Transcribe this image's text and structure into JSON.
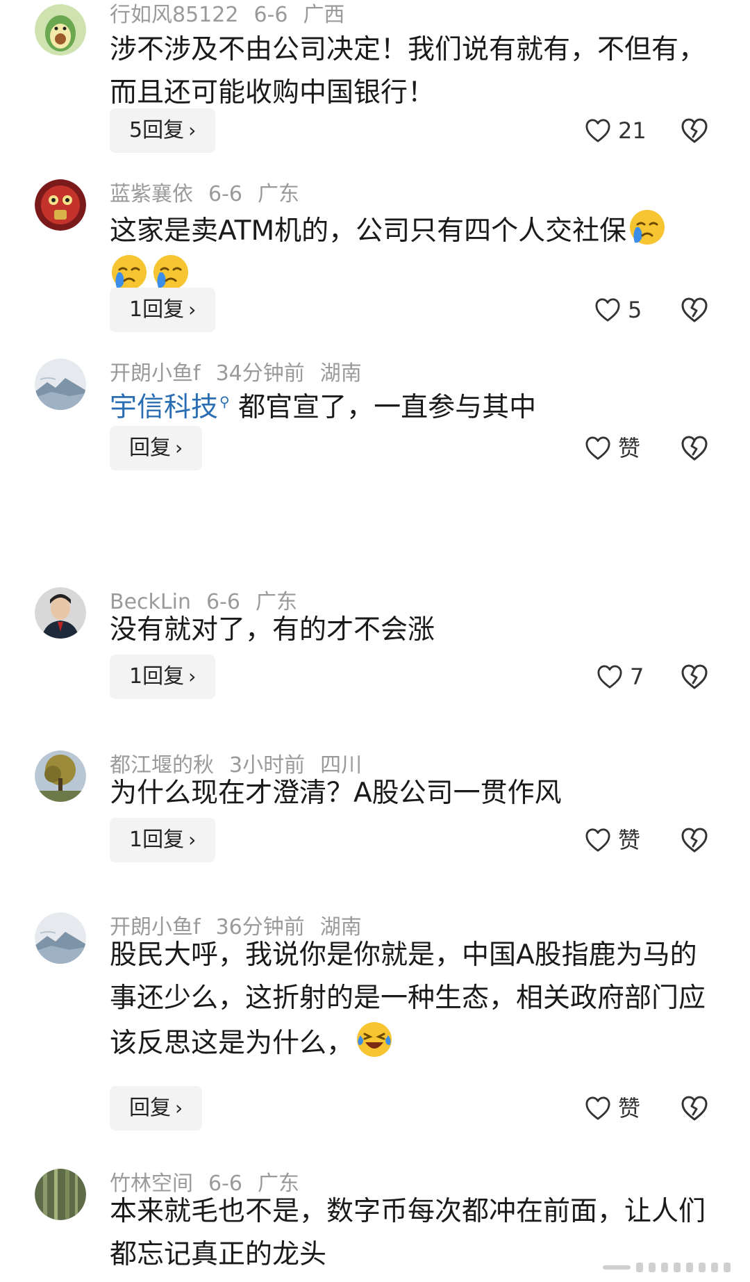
{
  "comments": [
    {
      "user": "行如风85122",
      "date": "6-6",
      "region": "广西",
      "text": "涉不涉及不由公司决定！我们说有就有，不但有，而且还可能收购中国银行！",
      "reply_label": "5回复",
      "like_label": "21"
    },
    {
      "user": "蓝紫襄依",
      "date": "6-6",
      "region": "广东",
      "text": "这家是卖ATM机的，公司只有四个人交社保",
      "reply_label": "1回复",
      "like_label": "5"
    },
    {
      "user": "开朗小鱼f",
      "date": "34分钟前",
      "region": "湖南",
      "mention": "宇信科技",
      "text": " 都官宣了，一直参与其中",
      "reply_label": "回复",
      "like_label": "赞"
    },
    {
      "user": "BeckLin",
      "date": "6-6",
      "region": "广东",
      "text": "没有就对了，有的才不会涨",
      "reply_label": "1回复",
      "like_label": "7"
    },
    {
      "user": "都江堰的秋",
      "date": "3小时前",
      "region": "四川",
      "text": "为什么现在才澄清？A股公司一贯作风",
      "reply_label": "1回复",
      "like_label": "赞"
    },
    {
      "user": "开朗小鱼f",
      "date": "36分钟前",
      "region": "湖南",
      "text": "股民大呼，我说你是你就是，中国A股指鹿为马的事还少么，这折射的是一种生态，相关政府部门应该反思这是为什么，",
      "reply_label": "回复",
      "like_label": "赞"
    },
    {
      "user": "竹林空间",
      "date": "6-6",
      "region": "广东",
      "text": "本来就毛也不是，数字币每次都冲在前面，让人们都忘记真正的龙头"
    }
  ],
  "icons": {
    "like": "heart-outline-icon",
    "dislike": "broken-heart-icon",
    "reply_arrow": "chevron-right-icon",
    "mention_search": "search-icon"
  },
  "colors": {
    "meta": "#9a9a9a",
    "mention": "#2a6db3",
    "button_bg": "#f3f3f3"
  }
}
